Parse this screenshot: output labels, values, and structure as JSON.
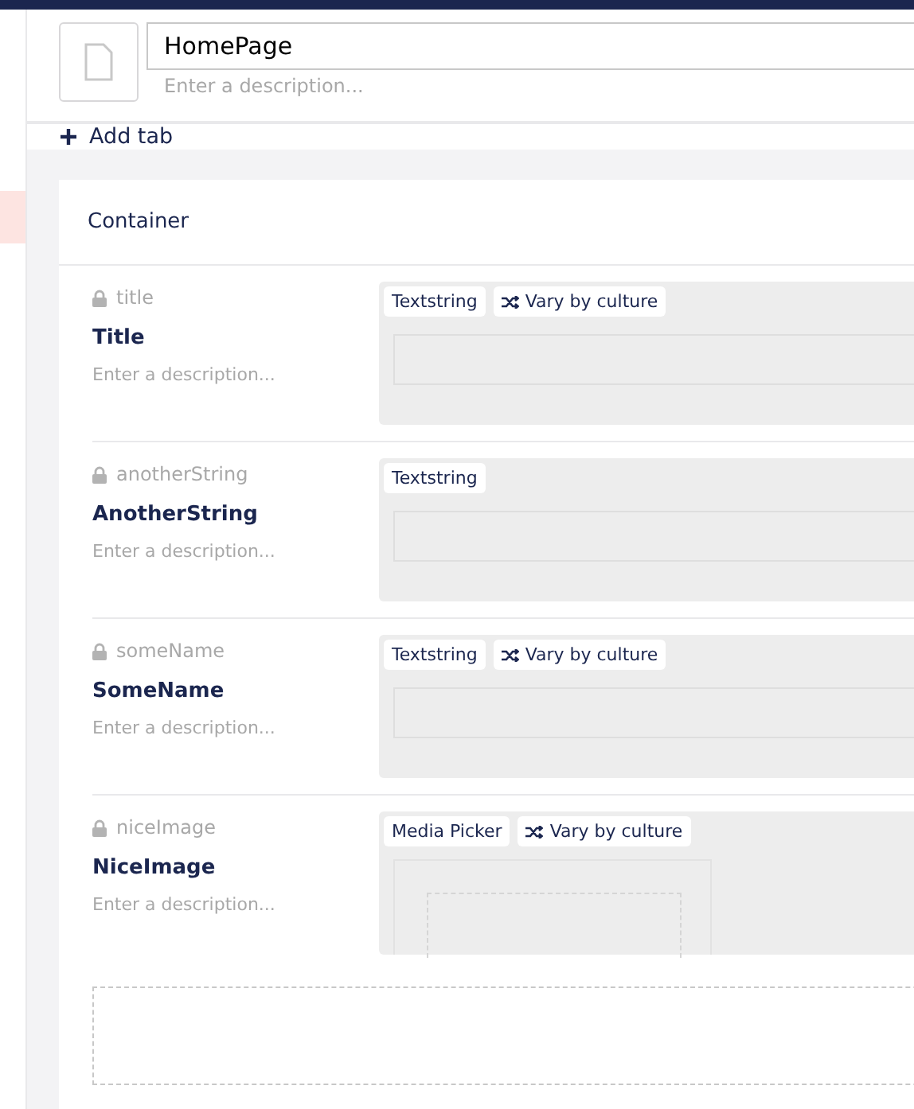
{
  "document": {
    "name": "HomePage",
    "description_placeholder": "Enter a description..."
  },
  "add_tab": {
    "label": "Add tab"
  },
  "group": {
    "name": "Container",
    "properties": [
      {
        "alias": "title",
        "locked": true,
        "name": "Title",
        "description_placeholder": "Enter a description...",
        "kind": "text",
        "tags": [
          {
            "label": "Textstring",
            "kind": "editor"
          },
          {
            "label": "Vary by culture",
            "kind": "variation"
          }
        ]
      },
      {
        "alias": "anotherString",
        "locked": true,
        "name": "AnotherString",
        "description_placeholder": "Enter a description...",
        "kind": "text",
        "tags": [
          {
            "label": "Textstring",
            "kind": "editor"
          }
        ]
      },
      {
        "alias": "someName",
        "locked": true,
        "name": "SomeName",
        "description_placeholder": "Enter a description...",
        "kind": "text",
        "tags": [
          {
            "label": "Textstring",
            "kind": "editor"
          },
          {
            "label": "Vary by culture",
            "kind": "variation"
          }
        ]
      },
      {
        "alias": "niceImage",
        "locked": true,
        "name": "NiceImage",
        "description_placeholder": "Enter a description...",
        "kind": "media",
        "tags": [
          {
            "label": "Media Picker",
            "kind": "editor"
          },
          {
            "label": "Vary by culture",
            "kind": "variation"
          }
        ]
      }
    ]
  }
}
